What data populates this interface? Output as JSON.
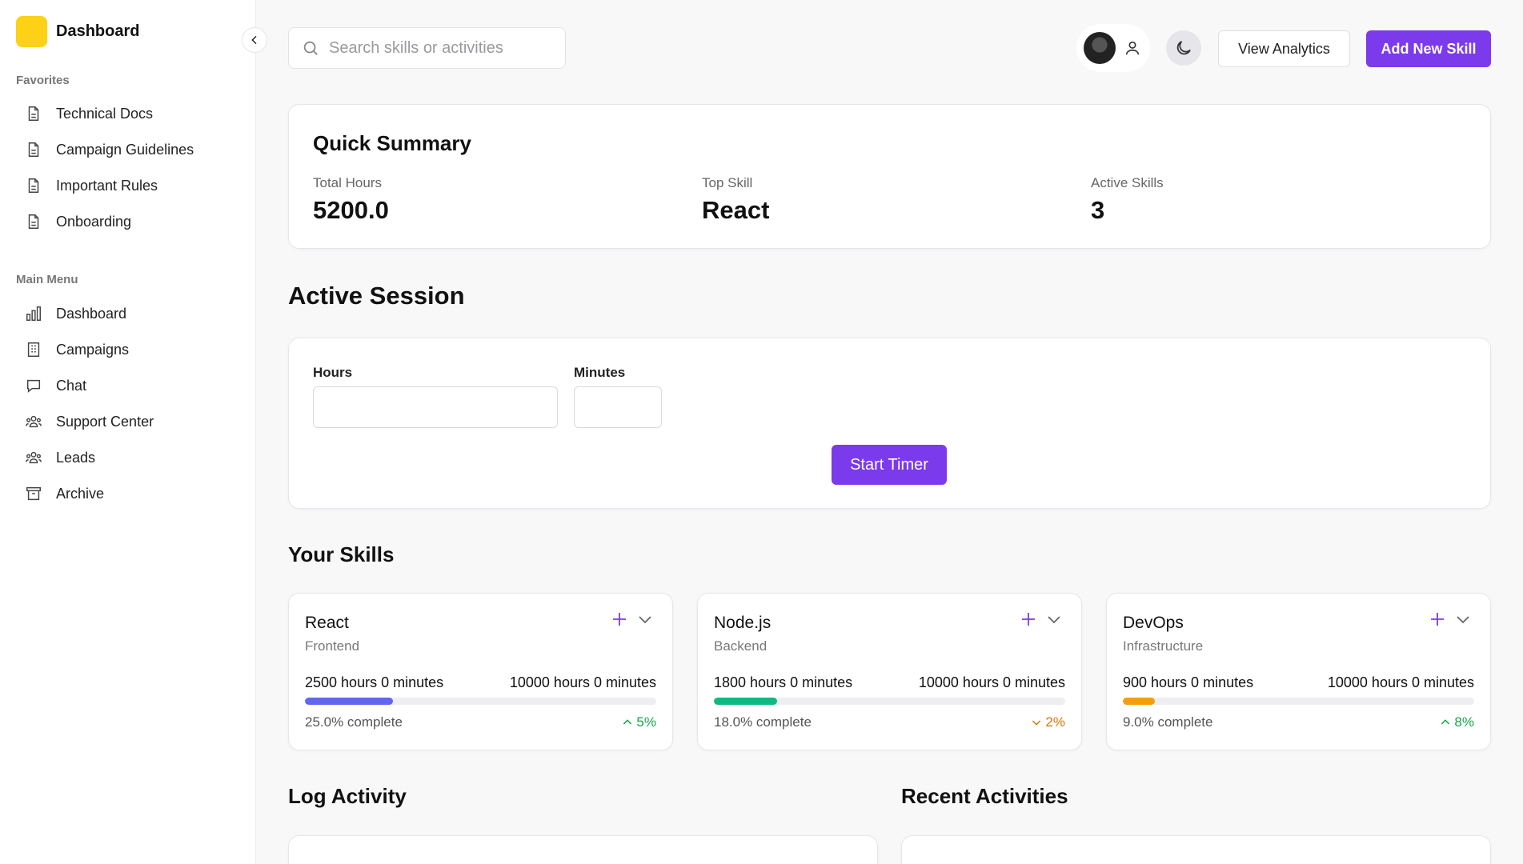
{
  "sidebar": {
    "brand": "Dashboard",
    "favorites_label": "Favorites",
    "favorites": [
      {
        "label": "Technical Docs",
        "icon": "document-icon"
      },
      {
        "label": "Campaign Guidelines",
        "icon": "document-icon"
      },
      {
        "label": "Important Rules",
        "icon": "document-icon"
      },
      {
        "label": "Onboarding",
        "icon": "document-icon"
      }
    ],
    "main_label": "Main Menu",
    "main": [
      {
        "label": "Dashboard",
        "icon": "bar-chart-icon"
      },
      {
        "label": "Campaigns",
        "icon": "building-icon"
      },
      {
        "label": "Chat",
        "icon": "chat-bubble-icon"
      },
      {
        "label": "Support Center",
        "icon": "users-icon"
      },
      {
        "label": "Leads",
        "icon": "users-icon"
      },
      {
        "label": "Archive",
        "icon": "archive-box-icon"
      }
    ]
  },
  "header": {
    "search_placeholder": "Search skills or activities",
    "view_analytics": "View Analytics",
    "add_skill": "Add New Skill"
  },
  "summary": {
    "title": "Quick Summary",
    "stats": [
      {
        "label": "Total Hours",
        "value": "5200.0"
      },
      {
        "label": "Top Skill",
        "value": "React"
      },
      {
        "label": "Active Skills",
        "value": "3"
      }
    ]
  },
  "session": {
    "title": "Active Session",
    "hours_label": "Hours",
    "minutes_label": "Minutes",
    "hours_value": "",
    "minutes_value": "",
    "start_label": "Start Timer"
  },
  "skills_title": "Your Skills",
  "skills": [
    {
      "name": "React",
      "category": "Frontend",
      "logged": "2500 hours 0 minutes",
      "goal": "10000 hours 0 minutes",
      "progress": 0.25,
      "complete": "25.0% complete",
      "trend": "5%",
      "trend_dir": "up",
      "color": "#6366f1",
      "trend_color": "#16a34a"
    },
    {
      "name": "Node.js",
      "category": "Backend",
      "logged": "1800 hours 0 minutes",
      "goal": "10000 hours 0 minutes",
      "progress": 0.18,
      "complete": "18.0% complete",
      "trend": "2%",
      "trend_dir": "down",
      "color": "#10b981",
      "trend_color": "#d97706"
    },
    {
      "name": "DevOps",
      "category": "Infrastructure",
      "logged": "900 hours 0 minutes",
      "goal": "10000 hours 0 minutes",
      "progress": 0.09,
      "complete": "9.0% complete",
      "trend": "8%",
      "trend_dir": "up",
      "color": "#f59e0b",
      "trend_color": "#16a34a"
    }
  ],
  "log_title": "Log Activity",
  "recent_title": "Recent Activities",
  "colors": {
    "accent": "#7c3aed",
    "brand_logo": "#fcd116"
  }
}
